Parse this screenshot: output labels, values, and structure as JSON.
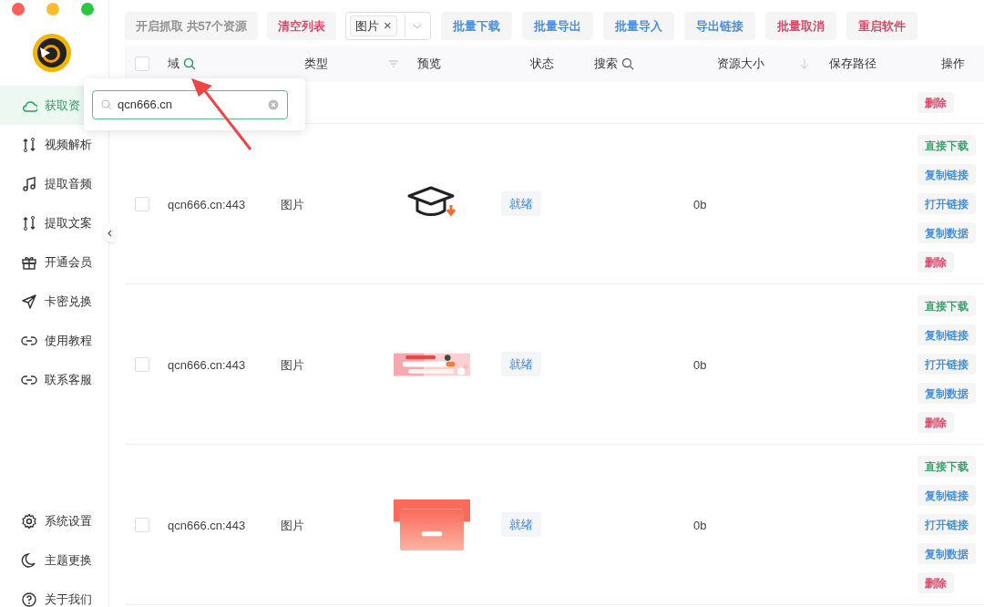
{
  "sidebar": {
    "items": [
      {
        "label": "获取资",
        "selected": true
      },
      {
        "label": "视频解析",
        "selected": false
      },
      {
        "label": "提取音频",
        "selected": false
      },
      {
        "label": "提取文案",
        "selected": false
      },
      {
        "label": "开通会员",
        "selected": false
      },
      {
        "label": "卡密兑换",
        "selected": false
      },
      {
        "label": "使用教程",
        "selected": false
      },
      {
        "label": "联系客服",
        "selected": false
      }
    ],
    "bottom_items": [
      {
        "label": "系统设置",
        "selected": false
      },
      {
        "label": "主题更换",
        "selected": false
      },
      {
        "label": "关于我们",
        "selected": false
      }
    ]
  },
  "toolbar": {
    "buttons": [
      {
        "label": "开启抓取 共57个资源",
        "color": "#888888"
      },
      {
        "label": "清空列表",
        "color": "#d8385a"
      }
    ],
    "filter": {
      "tag": "图片",
      "remove": "×"
    },
    "more_buttons": [
      {
        "label": "批量下载",
        "color": "#3a86e0"
      },
      {
        "label": "批量导出",
        "color": "#3a86e0"
      },
      {
        "label": "批量导入",
        "color": "#3a86e0"
      },
      {
        "label": "导出链接",
        "color": "#3a86e0"
      },
      {
        "label": "批量取消",
        "color": "#d8385a"
      },
      {
        "label": "重启软件",
        "color": "#d8385a"
      }
    ]
  },
  "table": {
    "select_all": {
      "checked": false
    },
    "columns": [
      "域",
      "类型",
      "预览",
      "状态",
      "搜索",
      "资源大小",
      "保存路径",
      "操作"
    ],
    "domain_search": {
      "value": "qcn666.cn"
    },
    "rows": [
      {
        "actions": [
          {
            "label": "删除",
            "color": "#d8385a"
          }
        ]
      },
      {
        "checked": false,
        "domain": "qcn666.cn:443",
        "type": "图片",
        "status": "就绪",
        "size": "0b",
        "actions": [
          {
            "label": "直接下载",
            "color": "#2f9d64"
          },
          {
            "label": "复制链接",
            "color": "#3a86e0"
          },
          {
            "label": "打开链接",
            "color": "#3a86e0"
          },
          {
            "label": "复制数据",
            "color": "#3a86e0"
          },
          {
            "label": "删除",
            "color": "#d8385a"
          }
        ]
      },
      {
        "checked": false,
        "domain": "qcn666.cn:443",
        "type": "图片",
        "status": "就绪",
        "size": "0b",
        "actions": [
          {
            "label": "直接下载",
            "color": "#2f9d64"
          },
          {
            "label": "复制链接",
            "color": "#3a86e0"
          },
          {
            "label": "打开链接",
            "color": "#3a86e0"
          },
          {
            "label": "复制数据",
            "color": "#3a86e0"
          },
          {
            "label": "删除",
            "color": "#d8385a"
          }
        ]
      },
      {
        "checked": false,
        "domain": "qcn666.cn:443",
        "type": "图片",
        "status": "就绪",
        "size": "0b",
        "actions": [
          {
            "label": "直接下载",
            "color": "#2f9d64"
          },
          {
            "label": "复制链接",
            "color": "#3a86e0"
          },
          {
            "label": "打开链接",
            "color": "#3a86e0"
          },
          {
            "label": "复制数据",
            "color": "#3a86e0"
          },
          {
            "label": "删除",
            "color": "#d8385a"
          }
        ]
      }
    ]
  }
}
